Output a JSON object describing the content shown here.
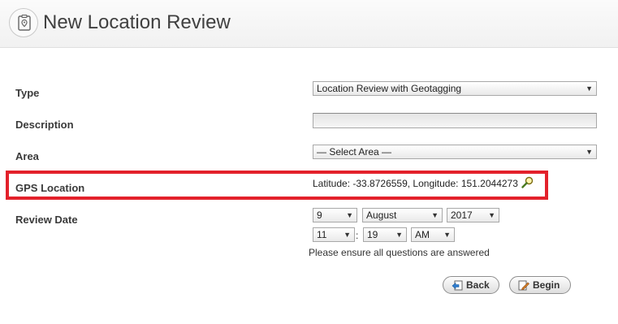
{
  "header": {
    "title": "New Location Review"
  },
  "form": {
    "type": {
      "label": "Type",
      "value": "Location Review with Geotagging"
    },
    "description": {
      "label": "Description",
      "value": ""
    },
    "area": {
      "label": "Area",
      "value": "— Select Area —"
    },
    "gps": {
      "label": "GPS Location",
      "value": "Latitude: -33.8726559, Longitude: 151.2044273"
    },
    "review_date": {
      "label": "Review Date",
      "day": "9",
      "month": "August",
      "year": "2017",
      "hour": "11",
      "minute": "19",
      "ampm": "AM"
    },
    "note": "Please ensure all questions are answered"
  },
  "buttons": {
    "back": "Back",
    "begin": "Begin"
  },
  "colors": {
    "highlight": "#e3212b"
  }
}
